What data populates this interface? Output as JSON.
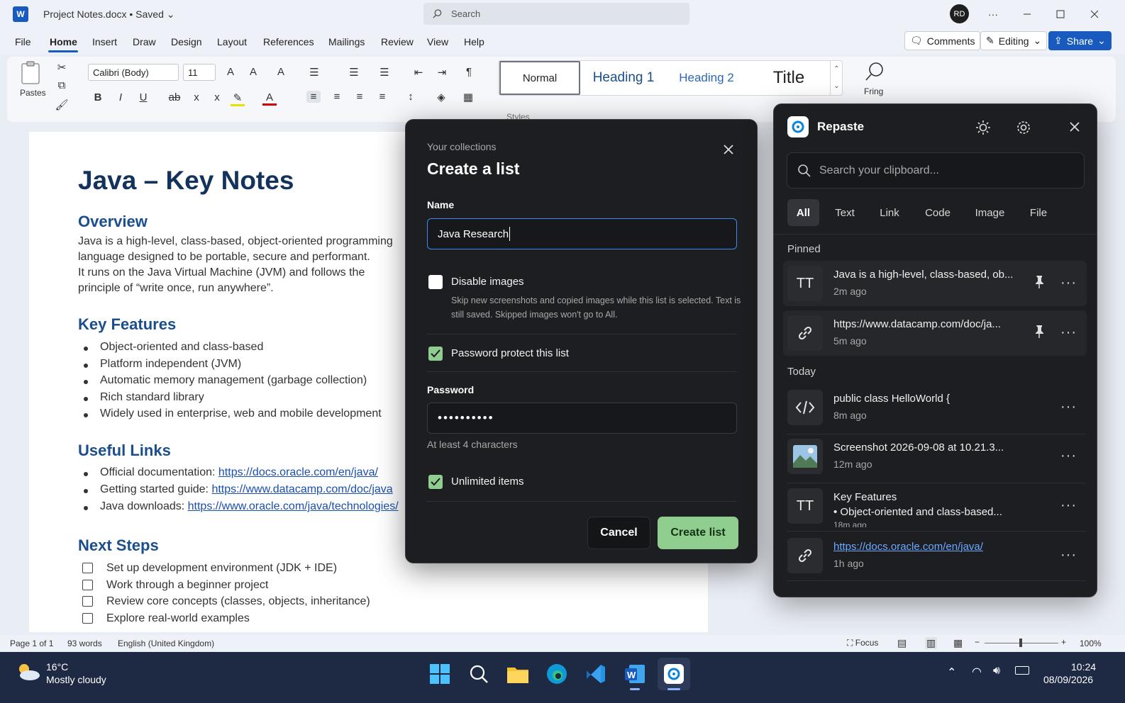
{
  "titlebar": {
    "app_letter": "W",
    "doc_title": "Project Notes.docx  •  Saved",
    "search_placeholder": "Search",
    "avatar": "RD",
    "more": "···"
  },
  "menu": {
    "items": [
      "File",
      "Home",
      "Insert",
      "Draw",
      "Design",
      "Layout",
      "References",
      "Mailings",
      "Review",
      "View",
      "Help"
    ],
    "comments": "Comments",
    "editing": "Editing",
    "share": "Share"
  },
  "ribbon": {
    "paste": "Pastes",
    "font": "Calibri (Body)",
    "size": "11",
    "styles": [
      "Normal",
      "Heading 1",
      "Heading 2",
      "Title"
    ],
    "styles_group": "Styles",
    "find": "Fring"
  },
  "document": {
    "title": "Java – Key Notes",
    "overview_h": "Overview",
    "overview_lines": [
      "Java is a high-level, class-based, object-oriented programming",
      "language designed to be portable, secure and performant.",
      "It runs on the Java Virtual Machine (JVM) and follows the",
      "principle of “write once, run anywhere”."
    ],
    "features_h": "Key Features",
    "features": [
      "Object-oriented and class-based",
      "Platform independent (JVM)",
      "Automatic memory management (garbage collection)",
      "Rich standard library",
      "Widely used in enterprise, web and mobile development"
    ],
    "links_h": "Useful Links",
    "links": [
      {
        "label": "Official documentation: ",
        "url": "https://docs.oracle.com/en/java/"
      },
      {
        "label": "Getting started guide: ",
        "url": "https://www.datacamp.com/doc/java"
      },
      {
        "label": "Java downloads: ",
        "url": "https://www.oracle.com/java/technologies/"
      }
    ],
    "next_h": "Next Steps",
    "next": [
      "Set up development environment (JDK + IDE)",
      "Work through a beginner project",
      "Review core concepts (classes, objects, inheritance)",
      "Explore real-world examples"
    ]
  },
  "status": {
    "page": "Page 1 of 1",
    "words": "93 words",
    "lang": "English (United Kingdom)",
    "focus": "Focus",
    "zoom": "100%"
  },
  "taskbar": {
    "temp": "16°C",
    "weather": "Mostly cloudy",
    "time": "10:24",
    "date": "08/09/2026"
  },
  "modal": {
    "eyebrow": "Your collections",
    "title": "Create a list",
    "name_label": "Name",
    "name_value": "Java Research",
    "disable_images": "Disable images",
    "disable_images_help_1": "Skip new screenshots and copied images while this list is selected. Text is",
    "disable_images_help_2": "still saved. Skipped images won't go to All.",
    "password_protect": "Password protect this list",
    "password_label": "Password",
    "password_value": "••••••••••",
    "password_hint": "At least 4 characters",
    "unlimited": "Unlimited items",
    "cancel": "Cancel",
    "create": "Create list"
  },
  "repaste": {
    "title": "Repaste",
    "search_placeholder": "Search your clipboard...",
    "tabs": [
      "All",
      "Text",
      "Link",
      "Code",
      "Image",
      "File"
    ],
    "pinned_h": "Pinned",
    "today_h": "Today",
    "pinned": [
      {
        "icon": "text-icon",
        "main": "Java is a high-level, class-based, ob...",
        "time": "2m ago"
      },
      {
        "icon": "link-icon",
        "main": "https://www.datacamp.com/doc/ja...",
        "time": "5m ago"
      }
    ],
    "today": [
      {
        "icon": "code-icon",
        "main": "public class HelloWorld {",
        "time": "8m ago"
      },
      {
        "icon": "image-icon",
        "main": "Screenshot 2026-09-08 at 10.21.3...",
        "time": "12m ago"
      },
      {
        "icon": "text-icon",
        "main": "Key Features",
        "sub": "• Object-oriented and class-based...",
        "time": "18m ago"
      },
      {
        "icon": "link-icon",
        "main": "https://docs.oracle.com/en/java/",
        "time": "1h ago"
      }
    ]
  }
}
